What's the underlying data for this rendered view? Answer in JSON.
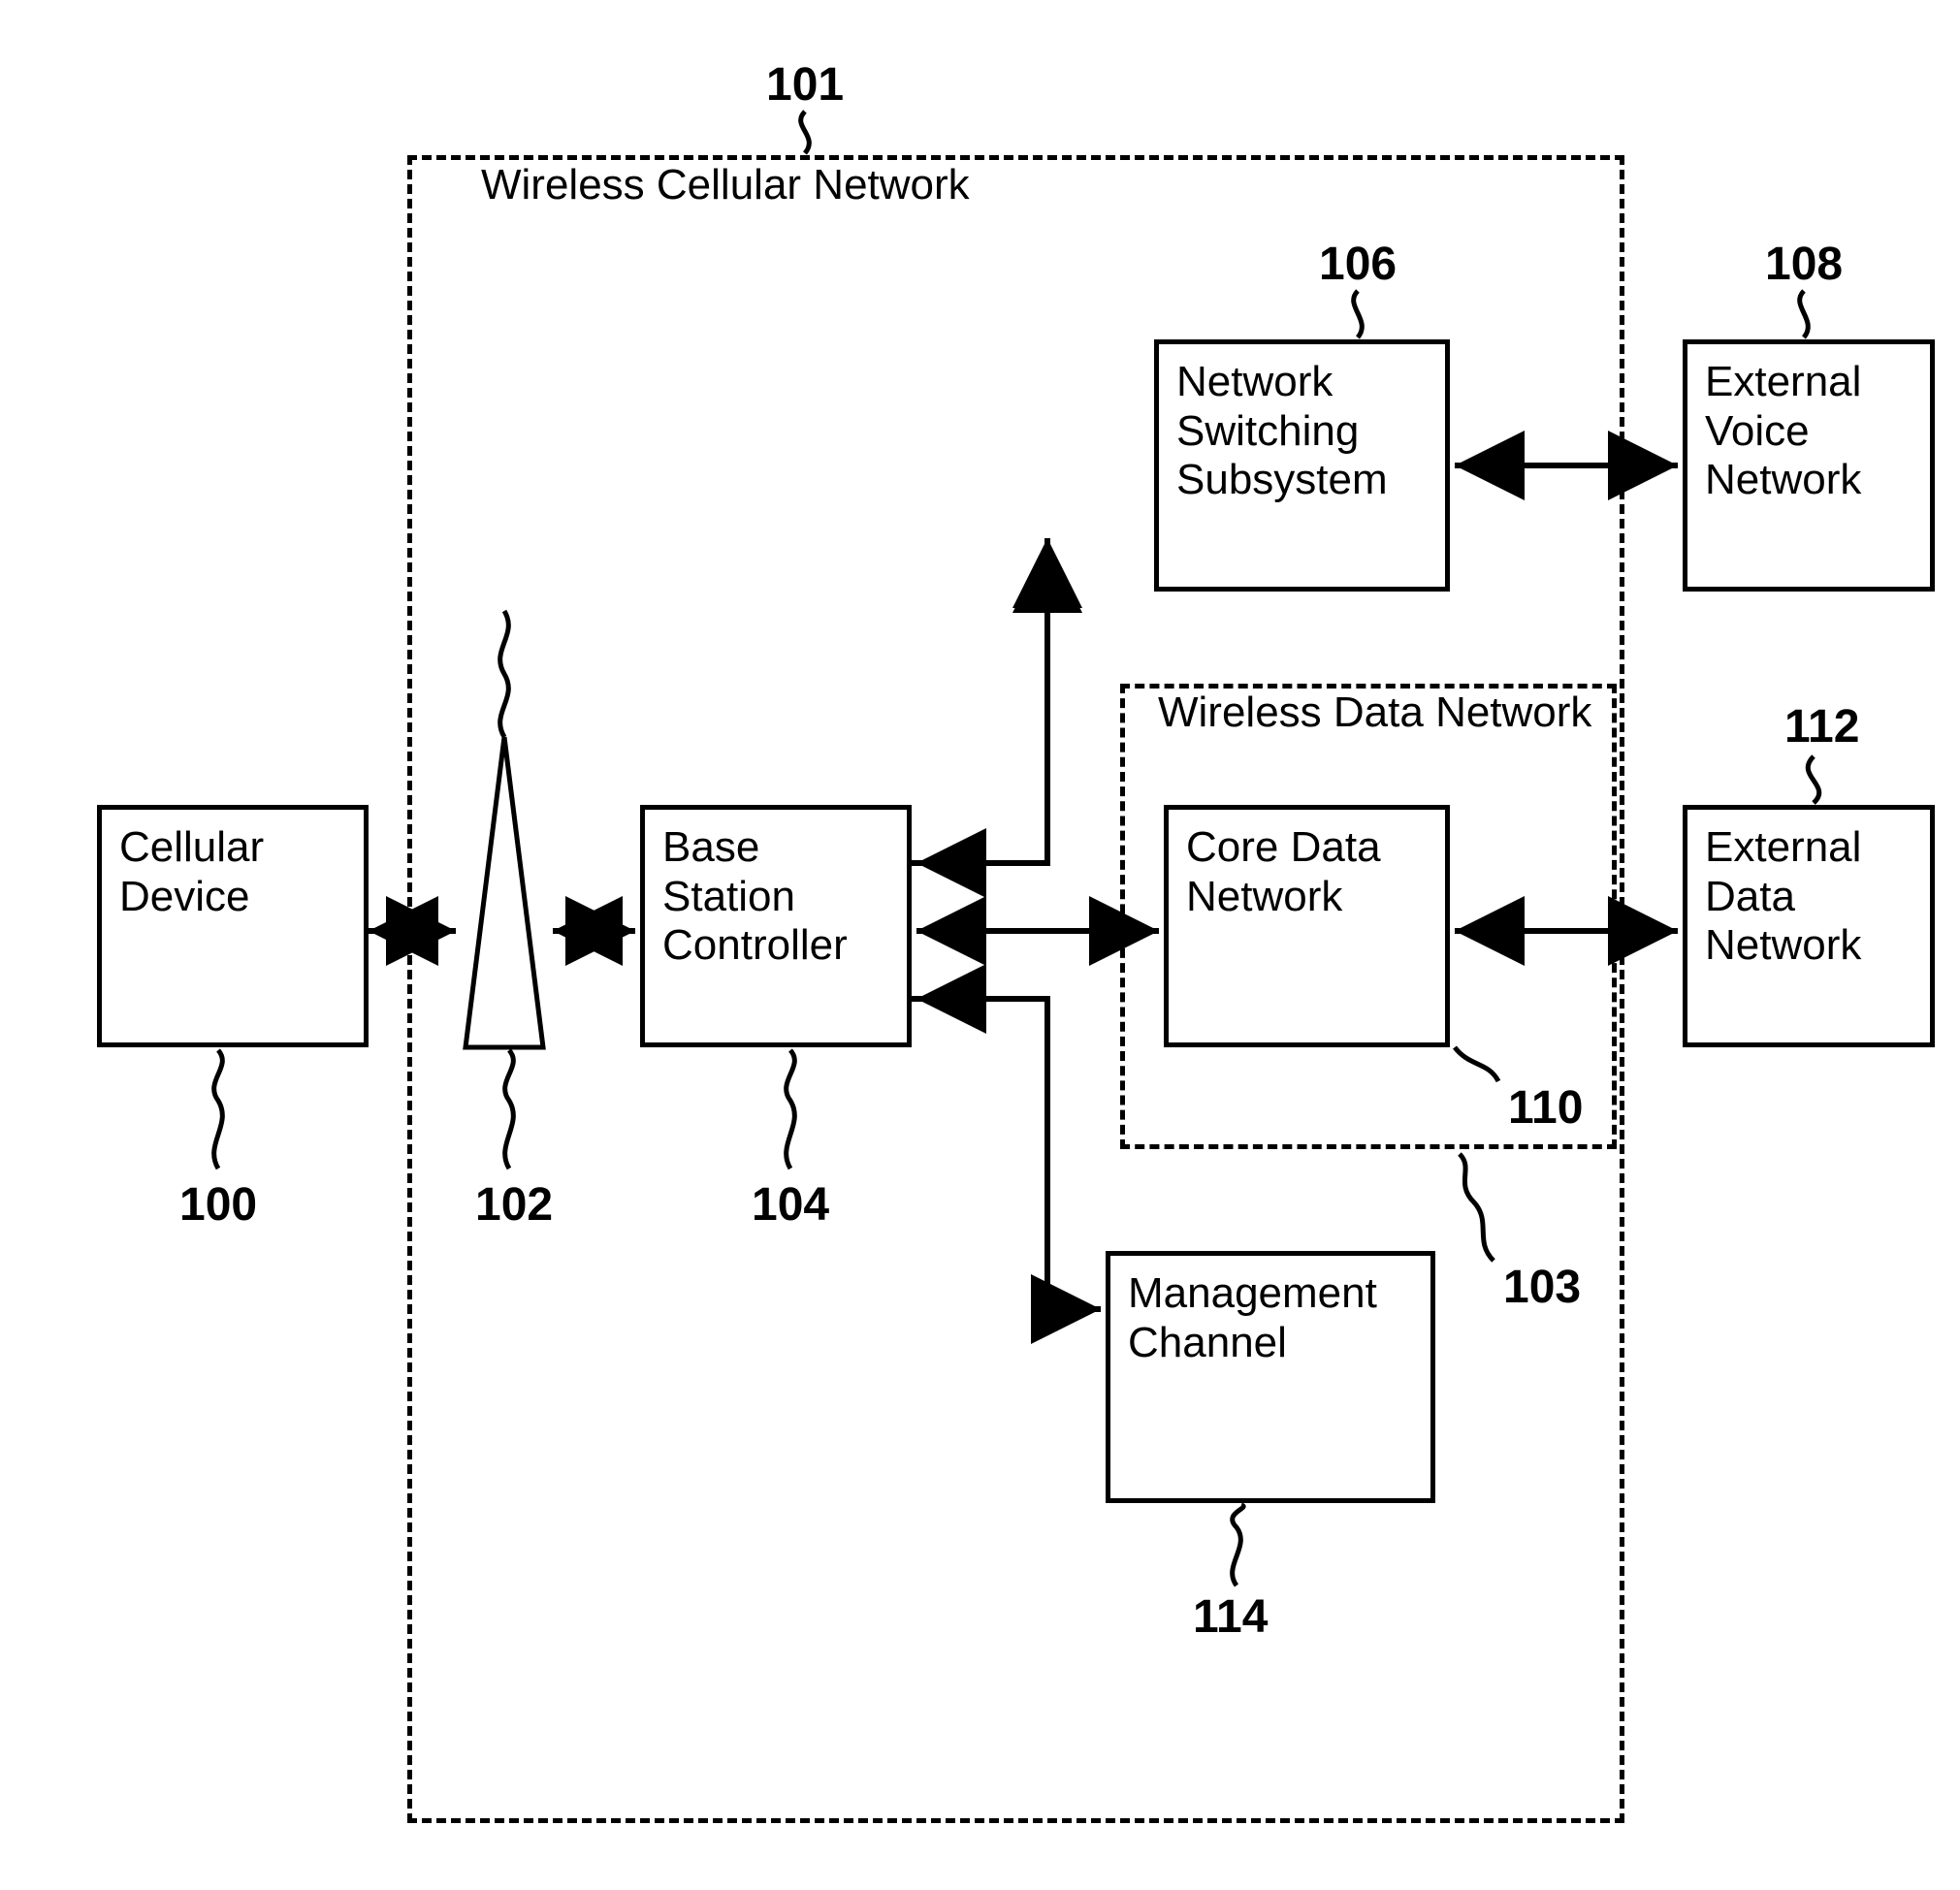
{
  "diagram": {
    "outerLabel": "Wireless Cellular Network",
    "innerLabel": "Wireless Data Network",
    "boxes": {
      "cellular": "Cellular Device",
      "bsc": "Base Station Controller",
      "nss": "Network Switching Subsystem",
      "cdn": "Core Data Network",
      "mgmt": "Management Channel",
      "evn": "External Voice Network",
      "edn": "External Data Network"
    },
    "refs": {
      "r100": "100",
      "r101": "101",
      "r102": "102",
      "r103": "103",
      "r104": "104",
      "r106": "106",
      "r108": "108",
      "r110": "110",
      "r112": "112",
      "r114": "114"
    }
  }
}
